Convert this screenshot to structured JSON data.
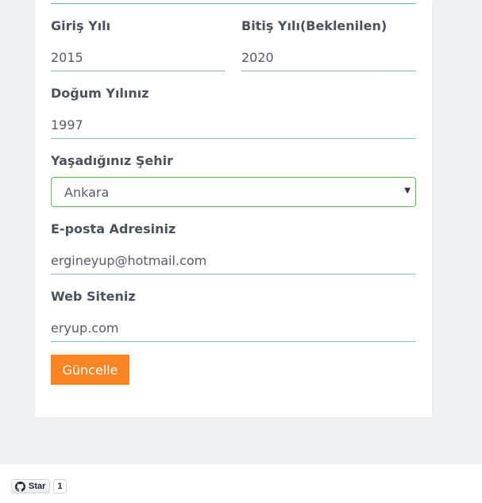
{
  "form": {
    "start_year": {
      "label": "Giriş Yılı",
      "value": "2015"
    },
    "end_year": {
      "label": "Bitiş Yılı(Beklenilen)",
      "value": "2020"
    },
    "birth_year": {
      "label": "Doğum Yılınız",
      "value": "1997"
    },
    "city": {
      "label": "Yaşadığınız Şehir",
      "value": "Ankara"
    },
    "email": {
      "label": "E-posta Adresiniz",
      "value": "ergineyup@hotmail.com"
    },
    "website": {
      "label": "Web Siteniz",
      "value": "eryup.com"
    },
    "submit_label": "Güncelle"
  },
  "github": {
    "star_label": "Star",
    "star_count": "1"
  },
  "colors": {
    "accent_button": "#fb8425",
    "field_underline": "#7ccaa9",
    "select_border": "#5cb85c",
    "page_background": "#eef1f5"
  },
  "icons": {
    "select_caret": "chevron-down-icon",
    "github": "github-icon"
  }
}
